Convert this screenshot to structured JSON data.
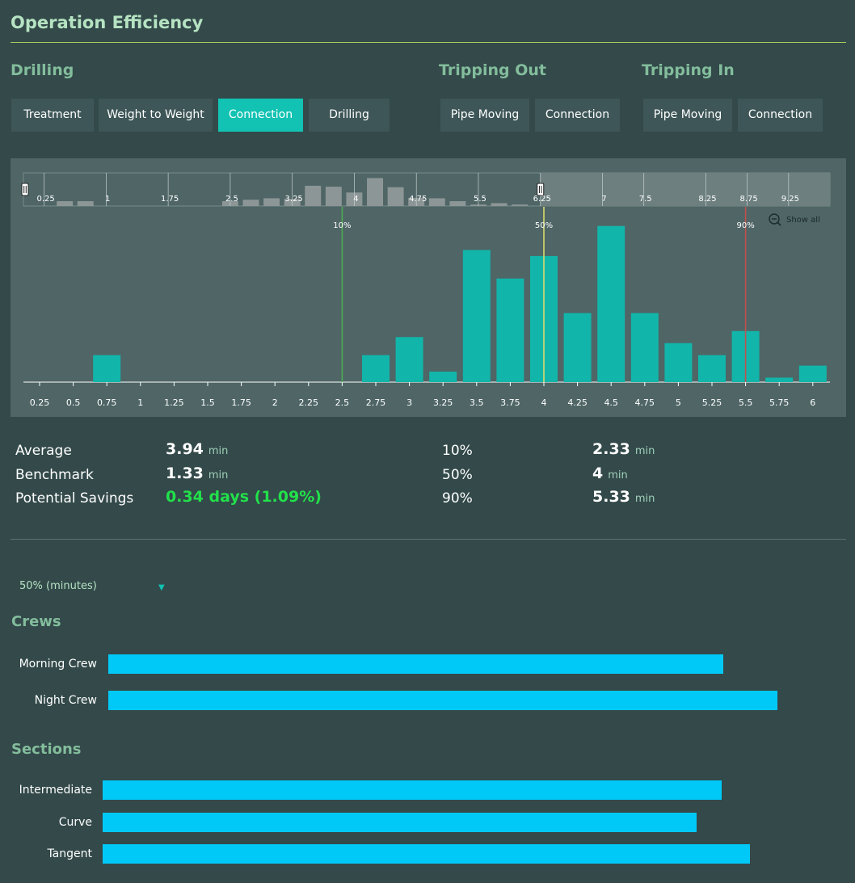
{
  "page": {
    "title": "Operation Efficiency"
  },
  "groups": [
    {
      "title": "Drilling",
      "tabs": [
        "Treatment",
        "Weight to Weight",
        "Connection",
        "Drilling"
      ],
      "active": 2
    },
    {
      "title": "Tripping Out",
      "tabs": [
        "Pipe Moving",
        "Connection"
      ],
      "active": null
    },
    {
      "title": "Tripping In",
      "tabs": [
        "Pipe Moving",
        "Connection"
      ],
      "active": null
    }
  ],
  "colors": {
    "background": "#33494a",
    "accent": "#12c2b2",
    "bar_main": "#12b5aa",
    "bar_overview": "#8d9696",
    "p10_line": "#4caf50",
    "p50_line": "#d9dc6b",
    "p90_line": "#c0504d",
    "crew_bar": "#00c9f8",
    "savings_green": "#22e04a"
  },
  "zoom": {
    "show_all_label": "Show all",
    "icon": "zoom-out-icon"
  },
  "chart_data": [
    {
      "type": "bar",
      "role": "overview",
      "tick_labels": [
        "0.25",
        "1",
        "1.75",
        "2.5",
        "3.25",
        "4",
        "4.75",
        "5.5",
        "6.25",
        "7",
        "7.5",
        "8.25",
        "8.75",
        "9.25"
      ],
      "x": [
        0.5,
        0.75,
        2.5,
        2.75,
        3.0,
        3.25,
        3.5,
        3.75,
        4.0,
        4.25,
        4.5,
        4.75,
        5.0,
        5.25,
        5.5,
        5.75,
        6.0
      ],
      "values": [
        1,
        1,
        1,
        1.3,
        1.6,
        1.5,
        4.2,
        4.0,
        2.8,
        5.8,
        3.9,
        1.7,
        1.6,
        1.0,
        0.3,
        0.6,
        0.3
      ],
      "selection_range": [
        0,
        6.25
      ]
    },
    {
      "type": "bar",
      "role": "detail",
      "categories": [
        "0.25",
        "0.5",
        "0.75",
        "1",
        "1.25",
        "1.5",
        "1.75",
        "2",
        "2.25",
        "2.5",
        "2.75",
        "3",
        "3.25",
        "3.5",
        "3.75",
        "4",
        "4.25",
        "4.5",
        "4.75",
        "5",
        "5.25",
        "5.5",
        "5.75",
        "6"
      ],
      "values": [
        0,
        0,
        0.9,
        0,
        0,
        0,
        0,
        0,
        0,
        0,
        0.9,
        1.5,
        0.35,
        4.4,
        3.45,
        4.2,
        2.3,
        5.2,
        2.3,
        1.3,
        0.9,
        1.7,
        0.15,
        0.55
      ],
      "ylim": [
        0,
        5.3
      ],
      "markers": [
        {
          "label": "10%",
          "x": 2.5
        },
        {
          "label": "50%",
          "x": 4
        },
        {
          "label": "90%",
          "x": 5.5
        }
      ]
    }
  ],
  "stats": {
    "left": [
      {
        "label": "Average",
        "value": "3.94",
        "unit": "min",
        "highlight": false
      },
      {
        "label": "Benchmark",
        "value": "1.33",
        "unit": "min",
        "highlight": false
      },
      {
        "label": "Potential Savings",
        "value": "0.34 days (1.09%)",
        "unit": "",
        "highlight": true
      }
    ],
    "right": [
      {
        "label": "10%",
        "value": "2.33",
        "unit": "min"
      },
      {
        "label": "50%",
        "value": "4",
        "unit": "min"
      },
      {
        "label": "90%",
        "value": "5.33",
        "unit": "min"
      }
    ]
  },
  "metric_select": {
    "value": "50% (minutes)"
  },
  "crews": {
    "title": "Crews",
    "items": [
      {
        "label": "Morning Crew",
        "fraction": 0.917
      },
      {
        "label": "Night Crew",
        "fraction": 0.998
      }
    ]
  },
  "sections": {
    "title": "Sections",
    "items": [
      {
        "label": "Intermediate",
        "fraction": 0.954
      },
      {
        "label": "Curve",
        "fraction": 0.915
      },
      {
        "label": "Tangent",
        "fraction": 0.998
      }
    ]
  }
}
